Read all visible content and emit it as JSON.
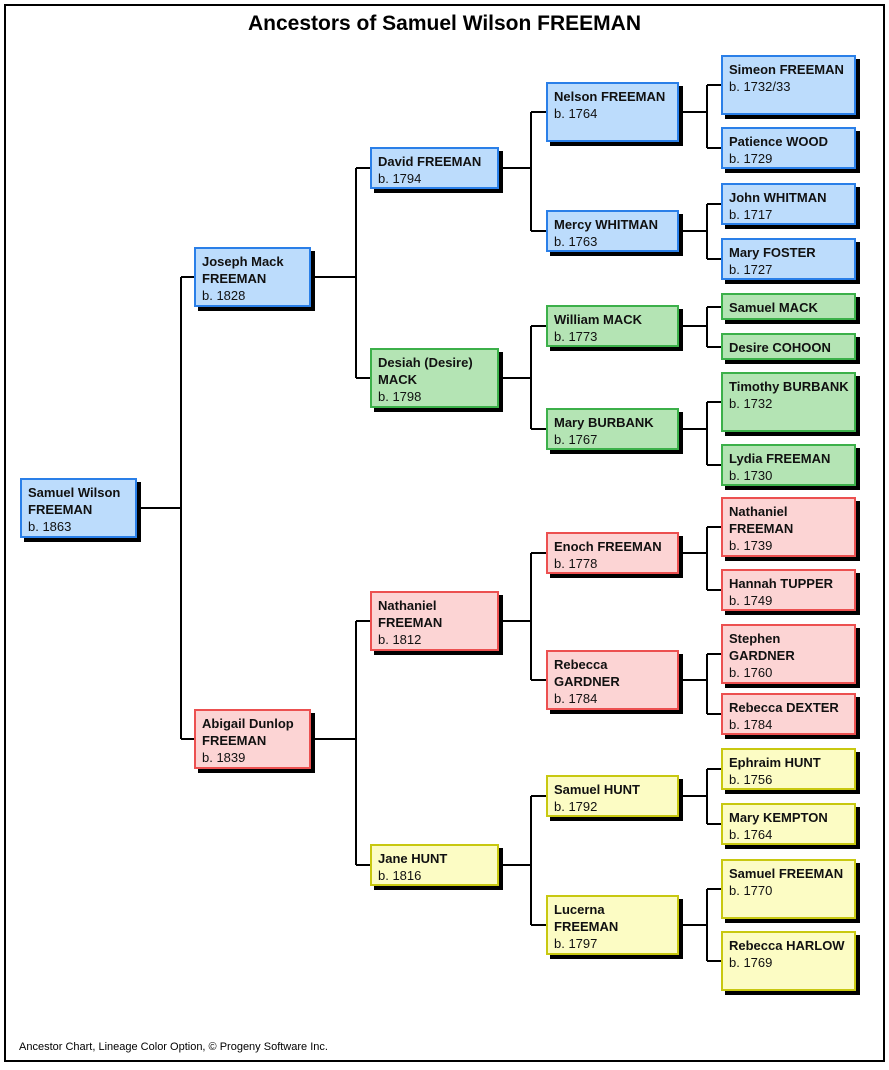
{
  "title": "Ancestors of Samuel Wilson FREEMAN",
  "footer": "Ancestor Chart, Lineage Color Option, © Progeny Software Inc.",
  "colors": {
    "blue_fill": "#bcdcfc",
    "blue_border": "#2a7fe8",
    "green_fill": "#b4e4b4",
    "green_border": "#3cb04a",
    "red_fill": "#fcd4d4",
    "red_border": "#ec5050",
    "yellow_fill": "#fcfcc4",
    "yellow_border": "#c8c810"
  },
  "people": {
    "p1": {
      "name": "Samuel Wilson FREEMAN",
      "birth": "b. 1863",
      "lineage": "blue"
    },
    "p2": {
      "name": "Joseph Mack FREEMAN",
      "birth": "b. 1828",
      "lineage": "blue"
    },
    "p3": {
      "name": "Abigail Dunlop FREEMAN",
      "birth": "b. 1839",
      "lineage": "red"
    },
    "p4": {
      "name": "David FREEMAN",
      "birth": "b. 1794",
      "lineage": "blue"
    },
    "p5": {
      "name": "Desiah (Desire) MACK",
      "birth": "b. 1798",
      "lineage": "green"
    },
    "p6": {
      "name": "Nathaniel FREEMAN",
      "birth": "b. 1812",
      "lineage": "red"
    },
    "p7": {
      "name": "Jane HUNT",
      "birth": "b. 1816",
      "lineage": "yellow"
    },
    "p8": {
      "name": "Nelson FREEMAN",
      "birth": "b. 1764",
      "lineage": "blue"
    },
    "p9": {
      "name": "Mercy WHITMAN",
      "birth": "b. 1763",
      "lineage": "blue"
    },
    "p10": {
      "name": "William MACK",
      "birth": "b. 1773",
      "lineage": "green"
    },
    "p11": {
      "name": "Mary BURBANK",
      "birth": "b. 1767",
      "lineage": "green"
    },
    "p12": {
      "name": "Enoch FREEMAN",
      "birth": "b. 1778",
      "lineage": "red"
    },
    "p13": {
      "name": "Rebecca GARDNER",
      "birth": "b. 1784",
      "lineage": "red"
    },
    "p14": {
      "name": "Samuel HUNT",
      "birth": "b. 1792",
      "lineage": "yellow"
    },
    "p15": {
      "name": "Lucerna FREEMAN",
      "birth": "b. 1797",
      "lineage": "yellow"
    },
    "p16": {
      "name": "Simeon FREEMAN",
      "birth": "b. 1732/33",
      "lineage": "blue"
    },
    "p17": {
      "name": "Patience WOOD",
      "birth": "b. 1729",
      "lineage": "blue"
    },
    "p18": {
      "name": "John WHITMAN",
      "birth": "b. 1717",
      "lineage": "blue"
    },
    "p19": {
      "name": "Mary FOSTER",
      "birth": "b. 1727",
      "lineage": "blue"
    },
    "p20": {
      "name": "Samuel MACK",
      "birth": "",
      "lineage": "green"
    },
    "p21": {
      "name": "Desire COHOON",
      "birth": "",
      "lineage": "green"
    },
    "p22": {
      "name": "Timothy BURBANK",
      "birth": "b. 1732",
      "lineage": "green"
    },
    "p23": {
      "name": "Lydia FREEMAN",
      "birth": "b. 1730",
      "lineage": "green"
    },
    "p24": {
      "name": "Nathaniel FREEMAN",
      "birth": "b. 1739",
      "lineage": "red"
    },
    "p25": {
      "name": "Hannah TUPPER",
      "birth": "b. 1749",
      "lineage": "red"
    },
    "p26": {
      "name": "Stephen GARDNER",
      "birth": "b. 1760",
      "lineage": "red"
    },
    "p27": {
      "name": "Rebecca DEXTER",
      "birth": "b. 1784",
      "lineage": "red"
    },
    "p28": {
      "name": "Ephraim HUNT",
      "birth": "b. 1756",
      "lineage": "yellow"
    },
    "p29": {
      "name": "Mary KEMPTON",
      "birth": "b. 1764",
      "lineage": "yellow"
    },
    "p30": {
      "name": "Samuel FREEMAN",
      "birth": "b. 1770",
      "lineage": "yellow"
    },
    "p31": {
      "name": "Rebecca HARLOW",
      "birth": "b. 1769",
      "lineage": "yellow"
    }
  }
}
